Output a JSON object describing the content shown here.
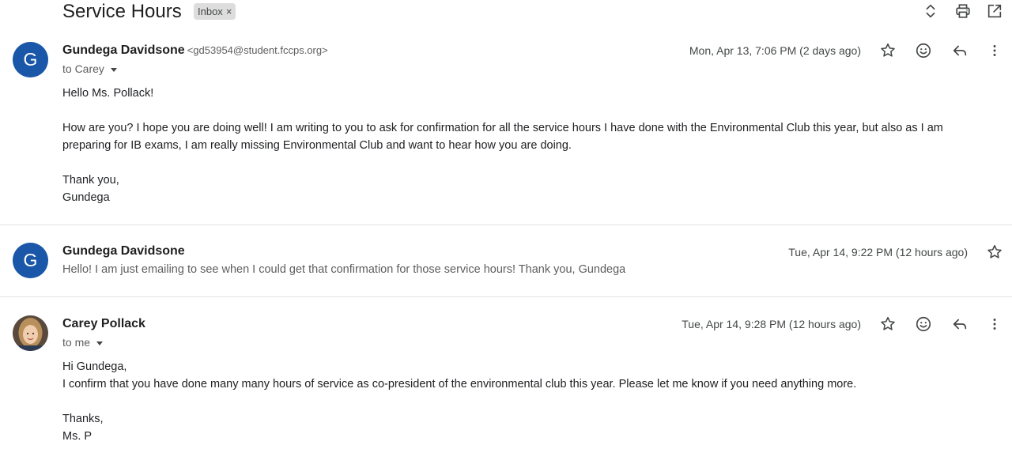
{
  "thread": {
    "subject": "Service Hours",
    "label": "Inbox",
    "label_remove_glyph": "×",
    "header_icons": [
      "expand-collapse-icon",
      "print-icon",
      "open-in-new-window-icon"
    ]
  },
  "messages": [
    {
      "avatar_letter": "G",
      "avatar_color": "#1a57a8",
      "sender_name": "Gundega Davidsone",
      "sender_email": "<gd53954@student.fccps.org>",
      "to": "to Carey",
      "date": "Mon, Apr 13, 7:06 PM (2 days ago)",
      "body": [
        "Hello Ms. Pollack!",
        "How are you? I hope you are doing well! I am writing to you to ask for confirmation for all the service hours I have done with the Environmental Club this year, but also as I am preparing for IB exams, I am really missing Environmental Club and want to hear how you are doing.",
        "Thank you,\nGundega"
      ]
    },
    {
      "avatar_letter": "G",
      "avatar_color": "#1a57a8",
      "sender_name": "Gundega Davidsone",
      "date": "Tue, Apr 14, 9:22 PM (12 hours ago)",
      "snippet": "Hello! I am just emailing to see when I could get that confirmation for those service hours! Thank you, Gundega"
    },
    {
      "avatar": "photo",
      "sender_name": "Carey Pollack",
      "to": "to me",
      "date": "Tue, Apr 14, 9:28 PM (12 hours ago)",
      "body": [
        "Hi Gundega,\nI confirm that you have done many many hours of service as co-president of the environmental club this year. Please let me know if you need anything more.",
        "Thanks,\nMs. P"
      ]
    }
  ],
  "message_actions": [
    "star-icon",
    "emoji-reaction-icon",
    "reply-icon",
    "more-options-icon"
  ]
}
